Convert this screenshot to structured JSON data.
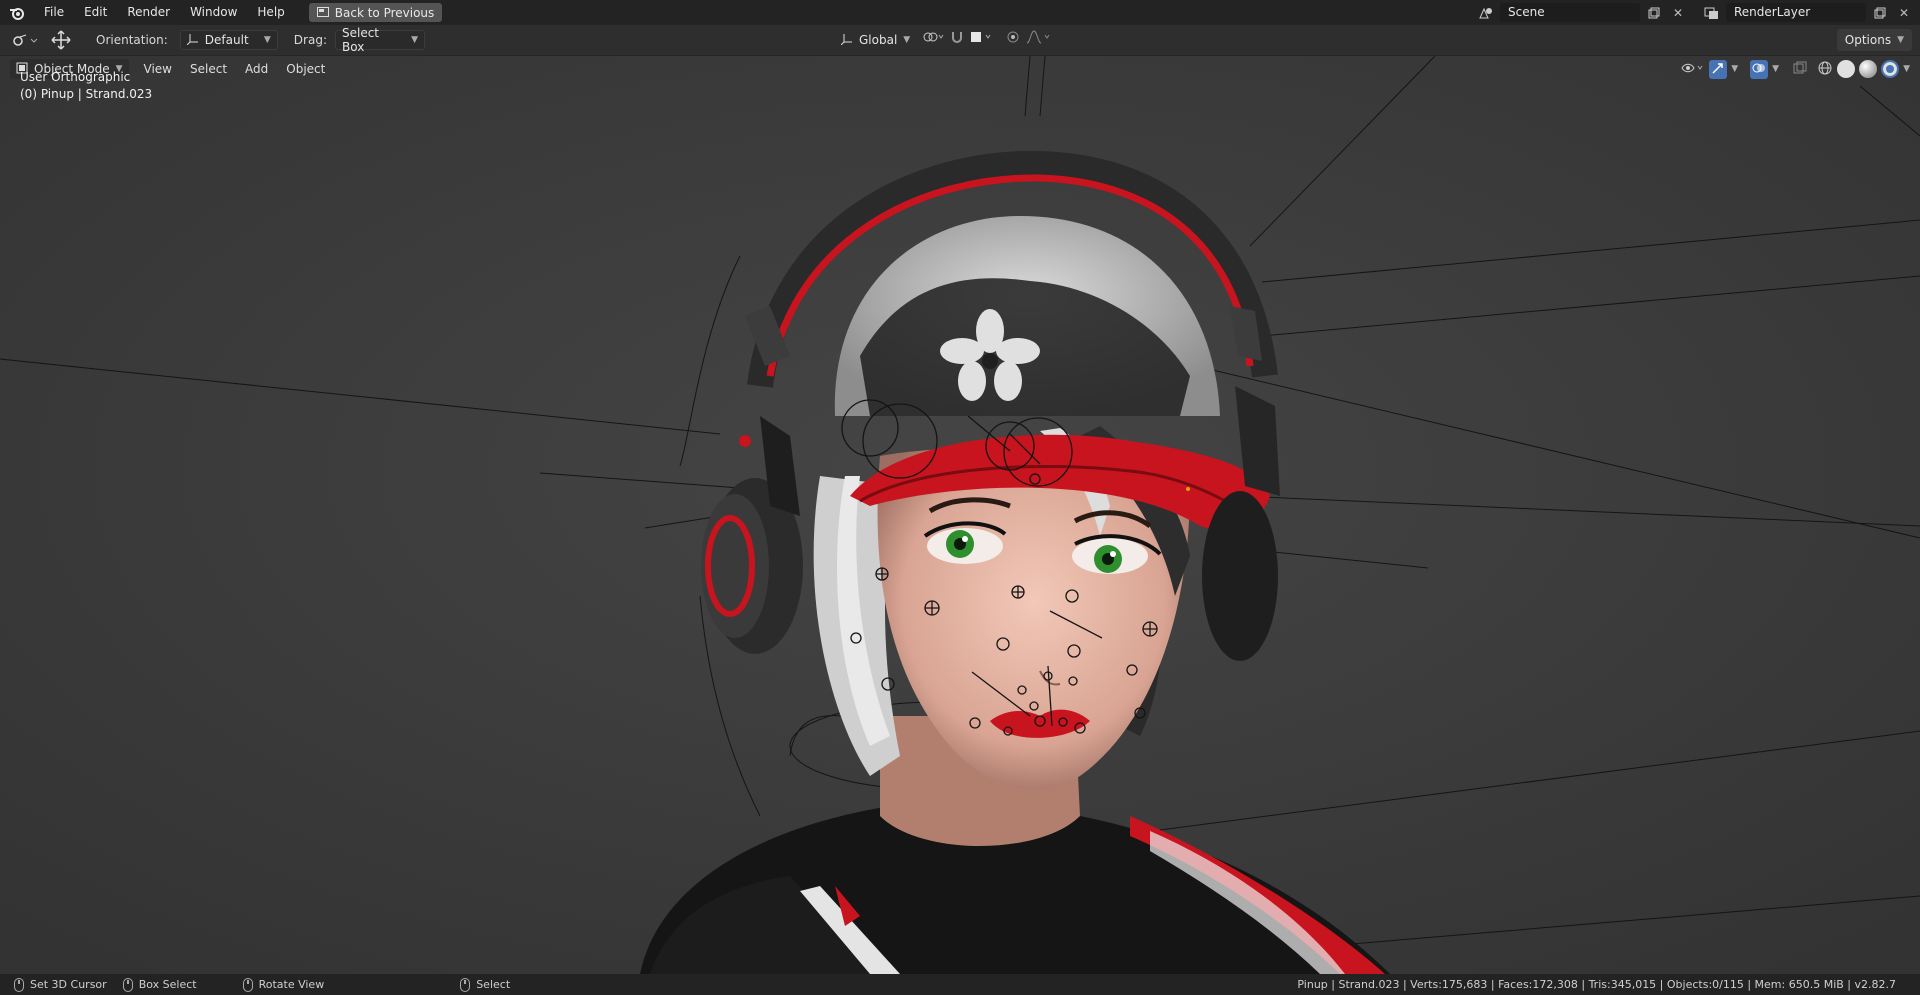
{
  "topbar": {
    "menu": [
      "File",
      "Edit",
      "Render",
      "Window",
      "Help"
    ],
    "back_button": "Back to Previous",
    "scene_name": "Scene",
    "view_layer_name": "RenderLayer"
  },
  "toolbar": {
    "orientation_label": "Orientation:",
    "orientation_value": "Default",
    "drag_label": "Drag:",
    "drag_value": "Select Box",
    "transform_orientation": "Global",
    "options_label": "Options"
  },
  "viewport": {
    "mode": "Object Mode",
    "menus": [
      "View",
      "Select",
      "Add",
      "Object"
    ],
    "view_name": "User Orthographic",
    "active_object": "(0) Pinup | Strand.023"
  },
  "statusbar": {
    "set_cursor": "Set 3D Cursor",
    "box_select": "Box Select",
    "rotate_view": "Rotate View",
    "select": "Select",
    "stats": "Pinup | Strand.023 | Verts:175,683 | Faces:172,308 | Tris:345,015 | Objects:0/115 | Mem: 650.5 MiB | v2.82.7"
  },
  "colors": {
    "accent_red": "#c8141e",
    "header_bg": "#232323",
    "viewport_bg": "#3b3b3b",
    "active_blue": "#4772b3"
  }
}
